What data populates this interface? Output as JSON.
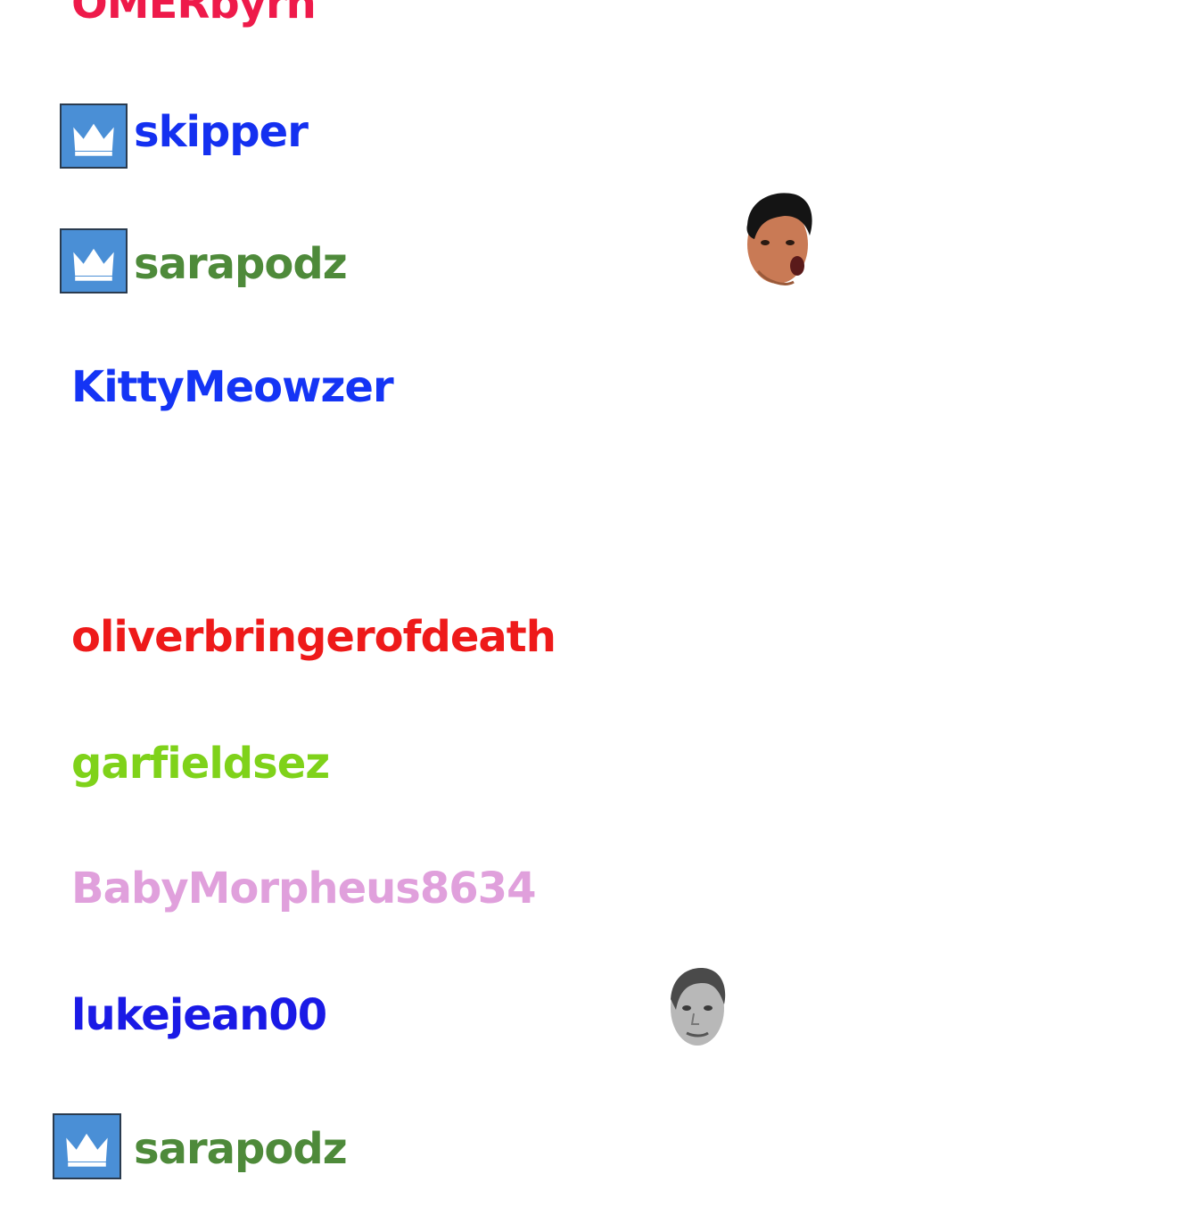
{
  "chat": {
    "messages": [
      {
        "username": "OMERbyrh",
        "color": "#ee1a4a",
        "badge": null,
        "emote": null
      },
      {
        "username": "skipper",
        "color": "#1430f0",
        "badge": "crown-icon",
        "emote": null
      },
      {
        "username": "sarapodz",
        "color": "#4e8a3a",
        "badge": "crown-icon",
        "emote": "pogchamp-emote"
      },
      {
        "username": "KittyMeowzer",
        "color": "#1434f5",
        "badge": null,
        "emote": null
      },
      {
        "username": "oliverbringerofdeath",
        "color": "#ee1a1a",
        "badge": null,
        "emote": null
      },
      {
        "username": "garfieldsez",
        "color": "#7fd21a",
        "badge": null,
        "emote": null
      },
      {
        "username": "BabyMorpheus8634",
        "color": "#e0a0dc",
        "badge": null,
        "emote": null
      },
      {
        "username": "lukejean00",
        "color": "#1a1ae6",
        "badge": null,
        "emote": "kappa-emote"
      },
      {
        "username": "sarapodz",
        "color": "#4e8a3a",
        "badge": "crown-icon",
        "emote": null
      }
    ]
  }
}
